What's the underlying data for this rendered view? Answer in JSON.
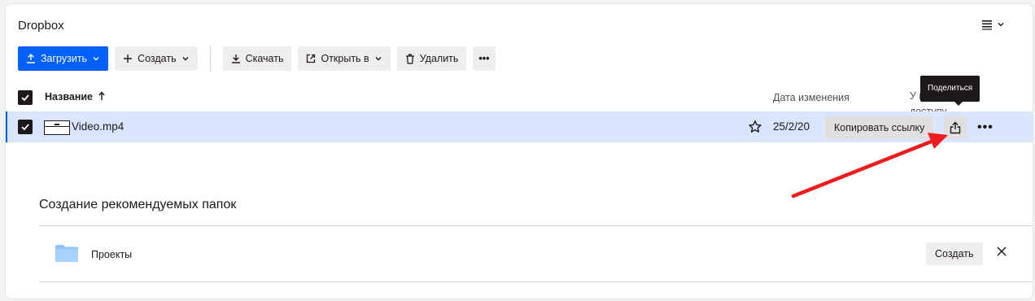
{
  "app": {
    "title": "Dropbox"
  },
  "toolbar": {
    "upload_label": "Загрузить",
    "create_label": "Создать",
    "download_label": "Скачать",
    "open_in_label": "Открыть в",
    "delete_label": "Удалить",
    "more_label": "•••"
  },
  "table": {
    "headers": {
      "name": "Название",
      "modified": "Дата изменения",
      "access": "У к доступу"
    },
    "rows": [
      {
        "name": "Video.mp4",
        "modified": "25/2/20",
        "copy_link": "Копировать ссылку",
        "more": "•••"
      }
    ]
  },
  "tooltip": {
    "text": "Поделиться"
  },
  "suggested": {
    "title": "Создание рекомендуемых папок",
    "folders": [
      {
        "name": "Проекты",
        "create_label": "Создать"
      }
    ]
  },
  "colors": {
    "accent": "#0061fe",
    "selected_row": "#dae6ff",
    "folder": "#90c4ff",
    "annotation_arrow": "#ee1c1c"
  }
}
